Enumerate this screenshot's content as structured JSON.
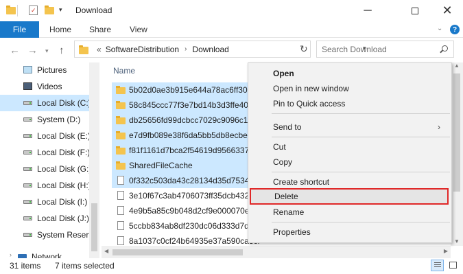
{
  "window": {
    "title": "Download"
  },
  "ribbon": {
    "file_tab": "File",
    "tabs": [
      "Home",
      "Share",
      "View"
    ],
    "expand_icon": "chevron-down-icon",
    "help_icon": "question-icon"
  },
  "address": {
    "overflow": "«",
    "crumbs": [
      "SoftwareDistribution",
      "Download"
    ],
    "search_placeholder": "Search Download"
  },
  "nav_pane": {
    "items": [
      {
        "label": "Pictures",
        "icon": "pictures-icon"
      },
      {
        "label": "Videos",
        "icon": "videos-icon"
      },
      {
        "label": "Local Disk (C:)",
        "icon": "drive-icon",
        "selected": true
      },
      {
        "label": "System (D:)",
        "icon": "drive-icon"
      },
      {
        "label": "Local Disk (E:)",
        "icon": "drive-icon"
      },
      {
        "label": "Local Disk (F:)",
        "icon": "drive-icon"
      },
      {
        "label": "Local Disk (G:)",
        "icon": "drive-icon"
      },
      {
        "label": "Local Disk (H:)",
        "icon": "drive-icon"
      },
      {
        "label": "Local Disk (I:)",
        "icon": "drive-icon"
      },
      {
        "label": "Local Disk (J:)",
        "icon": "drive-icon"
      },
      {
        "label": "System Reserved",
        "icon": "drive-icon"
      },
      {
        "label": "Network",
        "icon": "network-icon"
      }
    ]
  },
  "file_list": {
    "column_name": "Name",
    "files": [
      {
        "name": "5b02d0ae3b915e644a78ac6ff30ab1",
        "type": "folder",
        "selected": true
      },
      {
        "name": "58c845ccc77f3e7bd14b3d3ffe406a",
        "type": "folder",
        "selected": true
      },
      {
        "name": "db25656fd99dcbcc7029c9096c190",
        "type": "folder",
        "selected": true
      },
      {
        "name": "e7d9fb089e38f6da5bb5db8ecbef8",
        "type": "folder",
        "selected": true
      },
      {
        "name": "f81f1161d7bca2f54619d9566337ed",
        "type": "folder",
        "selected": true
      },
      {
        "name": "SharedFileCache",
        "type": "folder",
        "selected": true
      },
      {
        "name": "0f332c503da43c28134d35d7534ec",
        "type": "file",
        "selected": true
      },
      {
        "name": "3e10f67c3ab4706073ff35dcb43200",
        "type": "file",
        "selected": false
      },
      {
        "name": "4e9b5a85c9b048d2cf9e000070eb7",
        "type": "file",
        "selected": false
      },
      {
        "name": "5ccbb834ab8df230dc06d333d7d14",
        "type": "file",
        "selected": false
      },
      {
        "name": "8a1037c0cf24b64935e37a590ca3cf",
        "type": "file",
        "selected": false
      }
    ]
  },
  "context_menu": {
    "open": "Open",
    "open_new_window": "Open in new window",
    "pin_quick_access": "Pin to Quick access",
    "send_to": "Send to",
    "cut": "Cut",
    "copy": "Copy",
    "create_shortcut": "Create shortcut",
    "delete": "Delete",
    "rename": "Rename",
    "properties": "Properties",
    "highlight_color": "#e02828"
  },
  "status": {
    "item_count": "31 items",
    "selected_count": "7 items selected"
  },
  "colors": {
    "accent": "#1979ca",
    "selection": "#cce8ff",
    "folder": "#f4c44e"
  }
}
